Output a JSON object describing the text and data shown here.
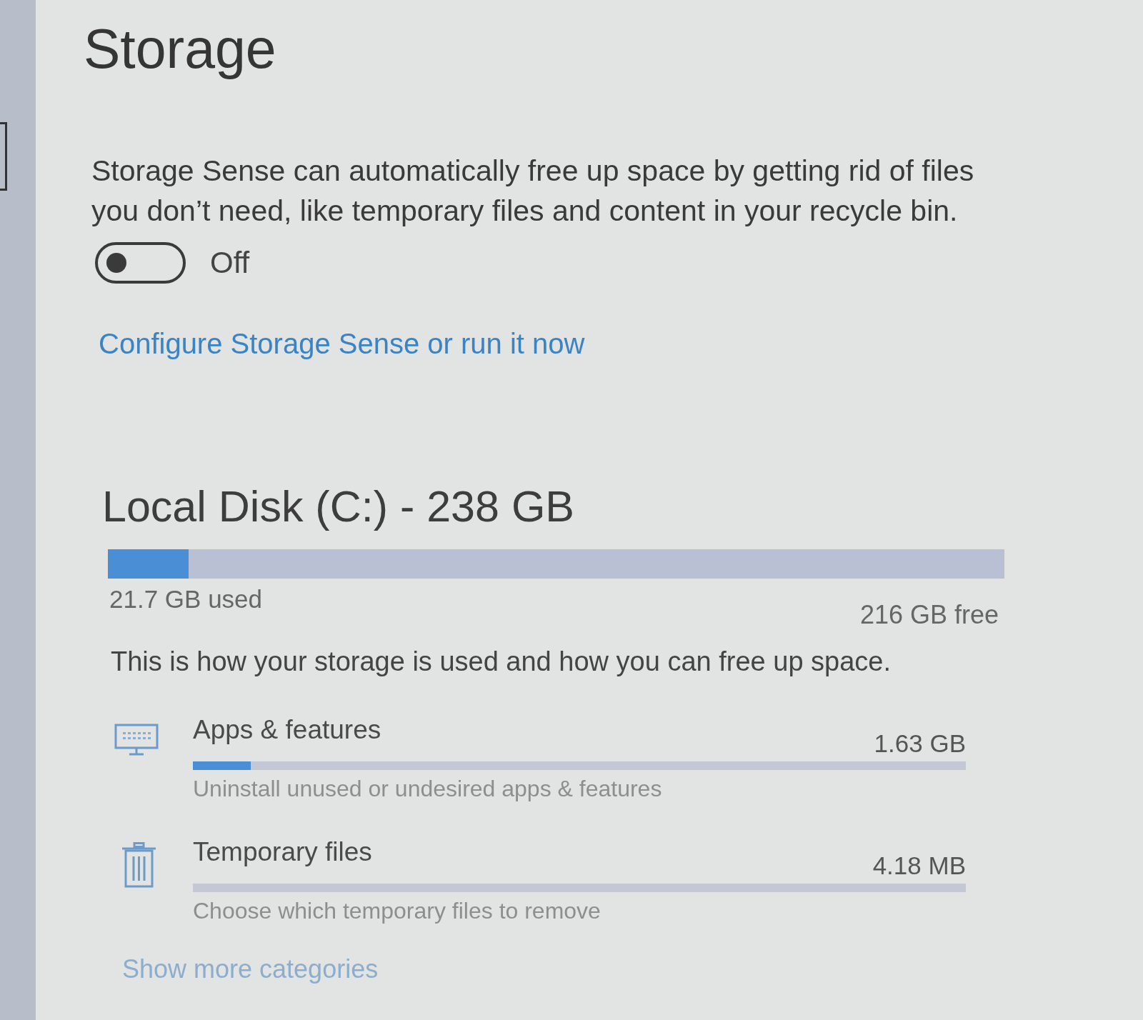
{
  "page_title": "Storage",
  "storage_sense": {
    "description": "Storage Sense can automatically free up space by getting rid of files you don’t need, like temporary files and content in your recycle bin.",
    "toggle": {
      "on": false,
      "label": "Off"
    },
    "link": "Configure Storage Sense or run it now"
  },
  "drive": {
    "title": "Local Disk (C:) - 238 GB",
    "level": 0.09,
    "used": "21.7 GB used",
    "free": "216 GB free",
    "description": "This is how your storage is used and how you can free up space."
  },
  "categories": [
    {
      "kind": "apps",
      "title": "Apps & features",
      "size": "1.63 GB",
      "level": 0.075,
      "subtitle": "Uninstall unused or undesired apps & features"
    },
    {
      "kind": "temp",
      "title": "Temporary files",
      "size": "4.18 MB",
      "level": 0,
      "subtitle": "Choose which temporary files to remove"
    }
  ],
  "more_link": "Show more categories"
}
